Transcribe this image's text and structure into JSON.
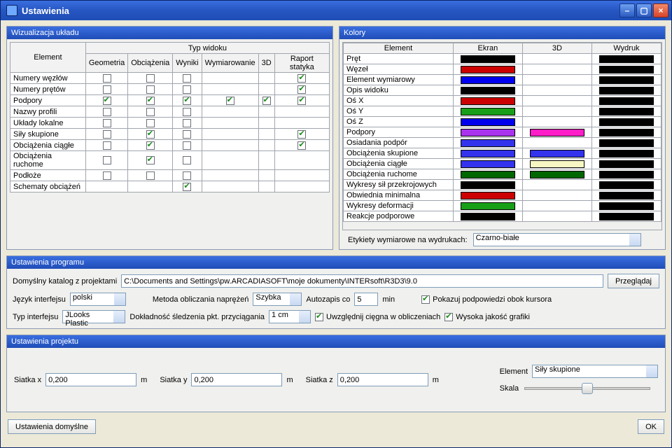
{
  "window": {
    "title": "Ustawienia"
  },
  "panels": {
    "vis": "Wizualizacja układu",
    "colors": "Kolory",
    "program": "Ustawienia programu",
    "project": "Ustawienia projektu"
  },
  "vis": {
    "groupHeader": "Typ widoku",
    "col_element": "Element",
    "cols": [
      "Geometria",
      "Obciążenia",
      "Wyniki",
      "Wymiarowanie",
      "3D",
      "Raport statyka"
    ],
    "rows": [
      {
        "name": "Numery węzłów",
        "v": [
          false,
          false,
          false,
          null,
          null,
          true
        ]
      },
      {
        "name": "Numery prętów",
        "v": [
          false,
          false,
          false,
          null,
          null,
          true
        ]
      },
      {
        "name": "Podpory",
        "v": [
          true,
          true,
          true,
          true,
          true,
          true
        ]
      },
      {
        "name": "Nazwy profili",
        "v": [
          false,
          false,
          false,
          null,
          null,
          null
        ]
      },
      {
        "name": "Układy lokalne",
        "v": [
          false,
          false,
          false,
          null,
          null,
          null
        ]
      },
      {
        "name": "Siły skupione",
        "v": [
          false,
          true,
          false,
          null,
          null,
          true
        ]
      },
      {
        "name": "Obciążenia ciągłe",
        "v": [
          false,
          true,
          false,
          null,
          null,
          true
        ]
      },
      {
        "name": "Obciążenia ruchome",
        "v": [
          false,
          true,
          false,
          null,
          null,
          null
        ]
      },
      {
        "name": "Podłoże",
        "v": [
          false,
          false,
          false,
          null,
          null,
          null
        ]
      },
      {
        "name": "Schematy obciążeń",
        "v": [
          null,
          null,
          true,
          null,
          null,
          null
        ]
      }
    ]
  },
  "colors": {
    "headers": [
      "Element",
      "Ekran",
      "3D",
      "Wydruk"
    ],
    "rows": [
      {
        "name": "Pręt",
        "ekran": "#000000",
        "d3": null,
        "wydruk": "#000000"
      },
      {
        "name": "Węzeł",
        "ekran": "#cc0000",
        "d3": null,
        "wydruk": "#000000"
      },
      {
        "name": "Element wymiarowy",
        "ekran": "#0000ee",
        "d3": null,
        "wydruk": "#000000"
      },
      {
        "name": "Opis widoku",
        "ekran": "#000000",
        "d3": null,
        "wydruk": "#000000"
      },
      {
        "name": "Oś X",
        "ekran": "#cc0000",
        "d3": null,
        "wydruk": "#000000"
      },
      {
        "name": "Oś Y",
        "ekran": "#17a017",
        "d3": null,
        "wydruk": "#000000"
      },
      {
        "name": "Oś Z",
        "ekran": "#0000ee",
        "d3": null,
        "wydruk": "#000000"
      },
      {
        "name": "Podpory",
        "ekran": "#aa33ee",
        "d3": "#ff1ec8",
        "wydruk": "#000000"
      },
      {
        "name": "Osiadania podpór",
        "ekran": "#3333ee",
        "d3": null,
        "wydruk": "#000000"
      },
      {
        "name": "Obciążenia skupione",
        "ekran": "#3333ee",
        "d3": "#3333ee",
        "wydruk": "#000000"
      },
      {
        "name": "Obciążenia ciągłe",
        "ekran": "#3333ee",
        "d3": "#f7f7c4",
        "wydruk": "#000000"
      },
      {
        "name": "Obciążenia ruchome",
        "ekran": "#006600",
        "d3": "#006600",
        "wydruk": "#000000"
      },
      {
        "name": "Wykresy sił przekrojowych",
        "ekran": "#000000",
        "d3": null,
        "wydruk": "#000000"
      },
      {
        "name": "Obwiednia minimalna",
        "ekran": "#cc0000",
        "d3": null,
        "wydruk": "#000000"
      },
      {
        "name": "Wykresy deformacji",
        "ekran": "#17a017",
        "d3": null,
        "wydruk": "#000000"
      },
      {
        "name": "Reakcje podporowe",
        "ekran": "#000000",
        "d3": null,
        "wydruk": "#000000"
      }
    ],
    "footerLabel": "Etykiety wymiarowe na wydrukach:",
    "footerValue": "Czarno-białe"
  },
  "program": {
    "katalogLabel": "Domyślny katalog z projektami",
    "katalogValue": "C:\\Documents and Settings\\pw.ARCADIASOFT\\moje dokumenty\\INTERsoft\\R3D3\\9.0",
    "browseLabel": "Przeglądaj",
    "jezykLabel": "Język interfejsu",
    "jezykValue": "polski",
    "typLabel": "Typ interfejsu",
    "typValue": "JLooks Plastic",
    "metodaLabel": "Metoda obliczania naprężeń",
    "metodaValue": "Szybka",
    "doklLabel": "Dokładność śledzenia pkt. przyciągania",
    "doklValue": "1 cm",
    "autozapisLabel": "Autozapis co",
    "autozapisValue": "5",
    "minLabel": "min",
    "uwzLabel": "Uwzględnij cięgna w obliczeniach",
    "uwzChecked": true,
    "hintLabel": "Pokazuj podpowiedzi obok kursora",
    "hintChecked": true,
    "hqLabel": "Wysoka jakość grafiki",
    "hqChecked": true
  },
  "project": {
    "siatkaXLabel": "Siatka x",
    "siatkaYLabel": "Siatka y",
    "siatkaZLabel": "Siatka z",
    "siatkaXValue": "0,200",
    "siatkaYValue": "0,200",
    "siatkaZValue": "0,200",
    "unit": "m",
    "elementLabel": "Element",
    "elementValue": "Siły skupione",
    "skalaLabel": "Skala"
  },
  "bottom": {
    "defaults": "Ustawienia domyślne",
    "ok": "OK"
  }
}
